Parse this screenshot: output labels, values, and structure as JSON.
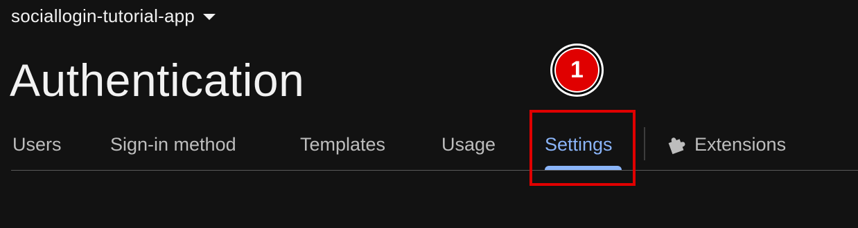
{
  "project": {
    "name": "sociallogin-tutorial-app",
    "dropdown_icon": "caret-down-icon"
  },
  "header": {
    "title": "Authentication"
  },
  "tabs": [
    {
      "label": "Users",
      "active": false
    },
    {
      "label": "Sign-in method",
      "active": false
    },
    {
      "label": "Templates",
      "active": false
    },
    {
      "label": "Usage",
      "active": false
    },
    {
      "label": "Settings",
      "active": true
    },
    {
      "label": "Extensions",
      "active": false,
      "icon": "puzzle-piece-icon"
    }
  ],
  "annotation": {
    "step_number": "1",
    "color": "#e00000"
  },
  "colors": {
    "background": "#121212",
    "active_tab": "#8ab4f8",
    "inactive_tab": "#bdbdbd",
    "highlight": "#e00000"
  }
}
